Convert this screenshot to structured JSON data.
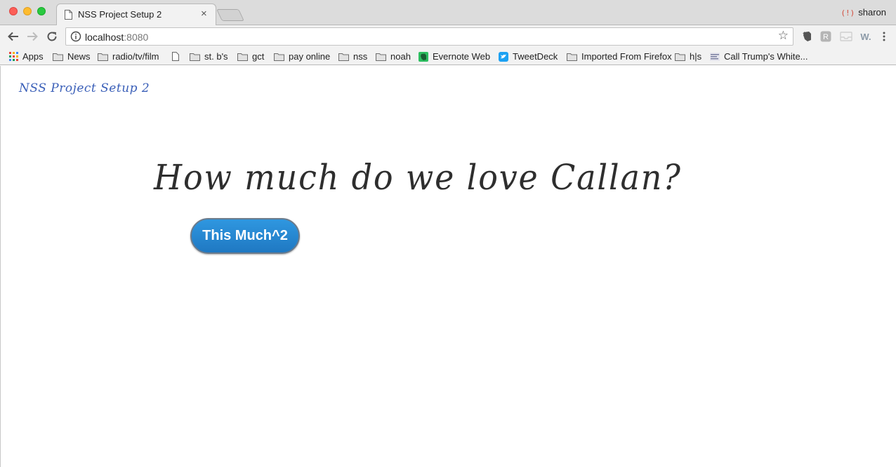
{
  "browser": {
    "tab": {
      "title": "NSS Project Setup 2",
      "close_label": "×"
    },
    "profile": {
      "icon": "profile-error-icon",
      "name": "sharon"
    },
    "address_bar": {
      "host": "localhost",
      "port": ":8080"
    },
    "icons": {
      "back": "back-arrow-icon",
      "forward": "forward-arrow-icon",
      "reload": "reload-icon",
      "info": "info-icon",
      "bookmark_star": "star-icon",
      "menu": "kebab-menu-icon"
    },
    "extensions": [
      "evernote-icon",
      "readkit-icon",
      "inbox-icon",
      "w-extension-icon"
    ],
    "extension_label_w": "W.",
    "bookmarks": [
      {
        "label": "Apps",
        "icon": "apps-grid-icon"
      },
      {
        "label": "News",
        "icon": "folder-icon"
      },
      {
        "label": "radio/tv/film",
        "icon": "folder-icon"
      },
      {
        "label": "",
        "icon": "page-icon"
      },
      {
        "label": "st. b's",
        "icon": "folder-icon"
      },
      {
        "label": "gct",
        "icon": "folder-icon"
      },
      {
        "label": "pay online",
        "icon": "folder-icon"
      },
      {
        "label": "nss",
        "icon": "folder-icon"
      },
      {
        "label": "noah",
        "icon": "folder-icon"
      },
      {
        "label": "Evernote Web",
        "icon": "evernote-icon"
      },
      {
        "label": "TweetDeck",
        "icon": "tweetdeck-icon"
      },
      {
        "label": "Imported From Firefox",
        "icon": "folder-icon"
      },
      {
        "label": "h|s",
        "icon": "folder-icon"
      },
      {
        "label": "Call Trump's White...",
        "icon": "site-favicon-icon"
      }
    ]
  },
  "page": {
    "site_title": "NSS Project Setup 2",
    "headline": "How much do we love Callan?",
    "button_label": "This Much^2"
  },
  "colors": {
    "site_title": "#3a5fb8",
    "headline": "#2e2e2e",
    "button_blue": "#2686d3",
    "evernote_green": "#2dbe60",
    "tweetdeck_blue": "#1da1f2"
  }
}
